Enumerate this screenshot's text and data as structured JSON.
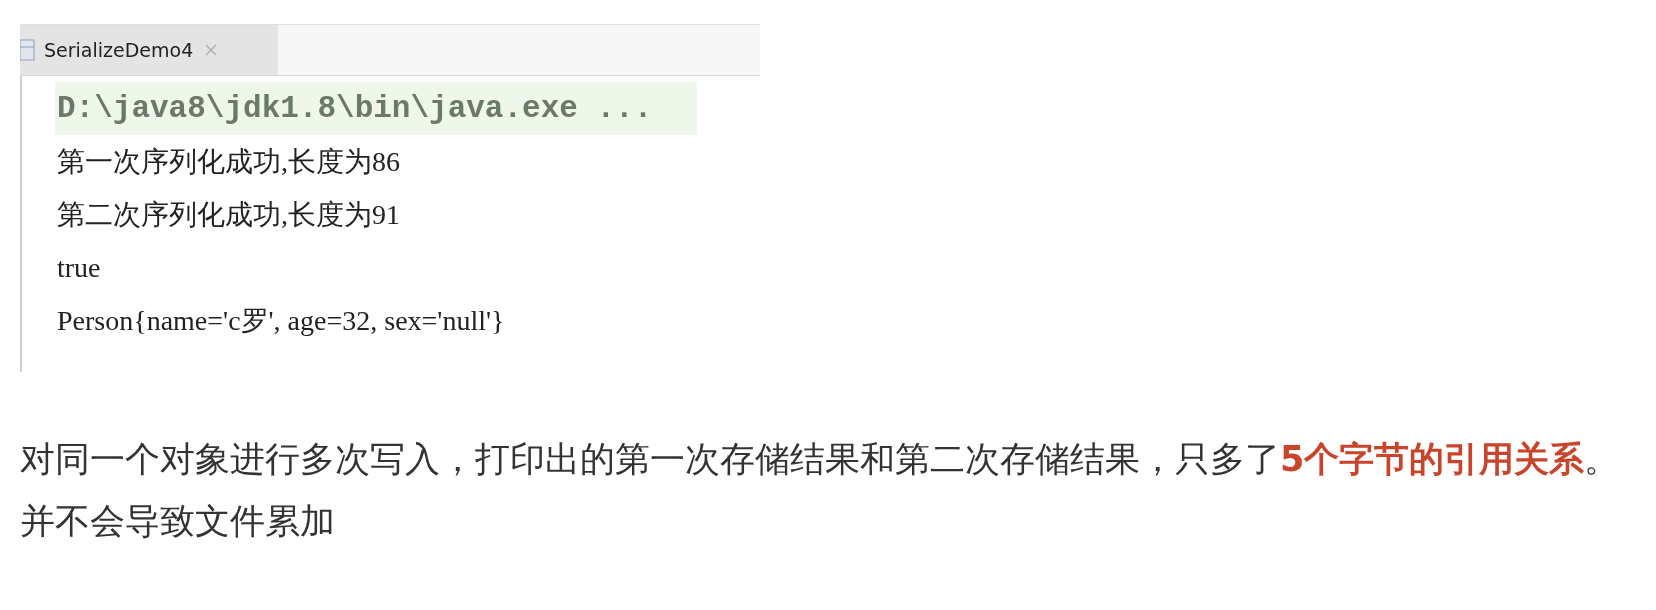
{
  "console_tab": {
    "title": "SerializeDemo4"
  },
  "console_lines": [
    {
      "kind": "command",
      "text": "D:\\java8\\jdk1.8\\bin\\java.exe ..."
    },
    {
      "kind": "output",
      "text": "第一次序列化成功,长度为86"
    },
    {
      "kind": "output",
      "text": "第二次序列化成功,长度为91"
    },
    {
      "kind": "output",
      "text": "true"
    },
    {
      "kind": "output",
      "text": "Person{name='c罗', age=32, sex='null'}"
    }
  ],
  "paragraph_lines": [
    "对同一个对象进行多次写入，打印出的第一次存储结果和第二次存储结果，只多了**5个字节的引用关系**。",
    "并不会导致文件累加"
  ]
}
